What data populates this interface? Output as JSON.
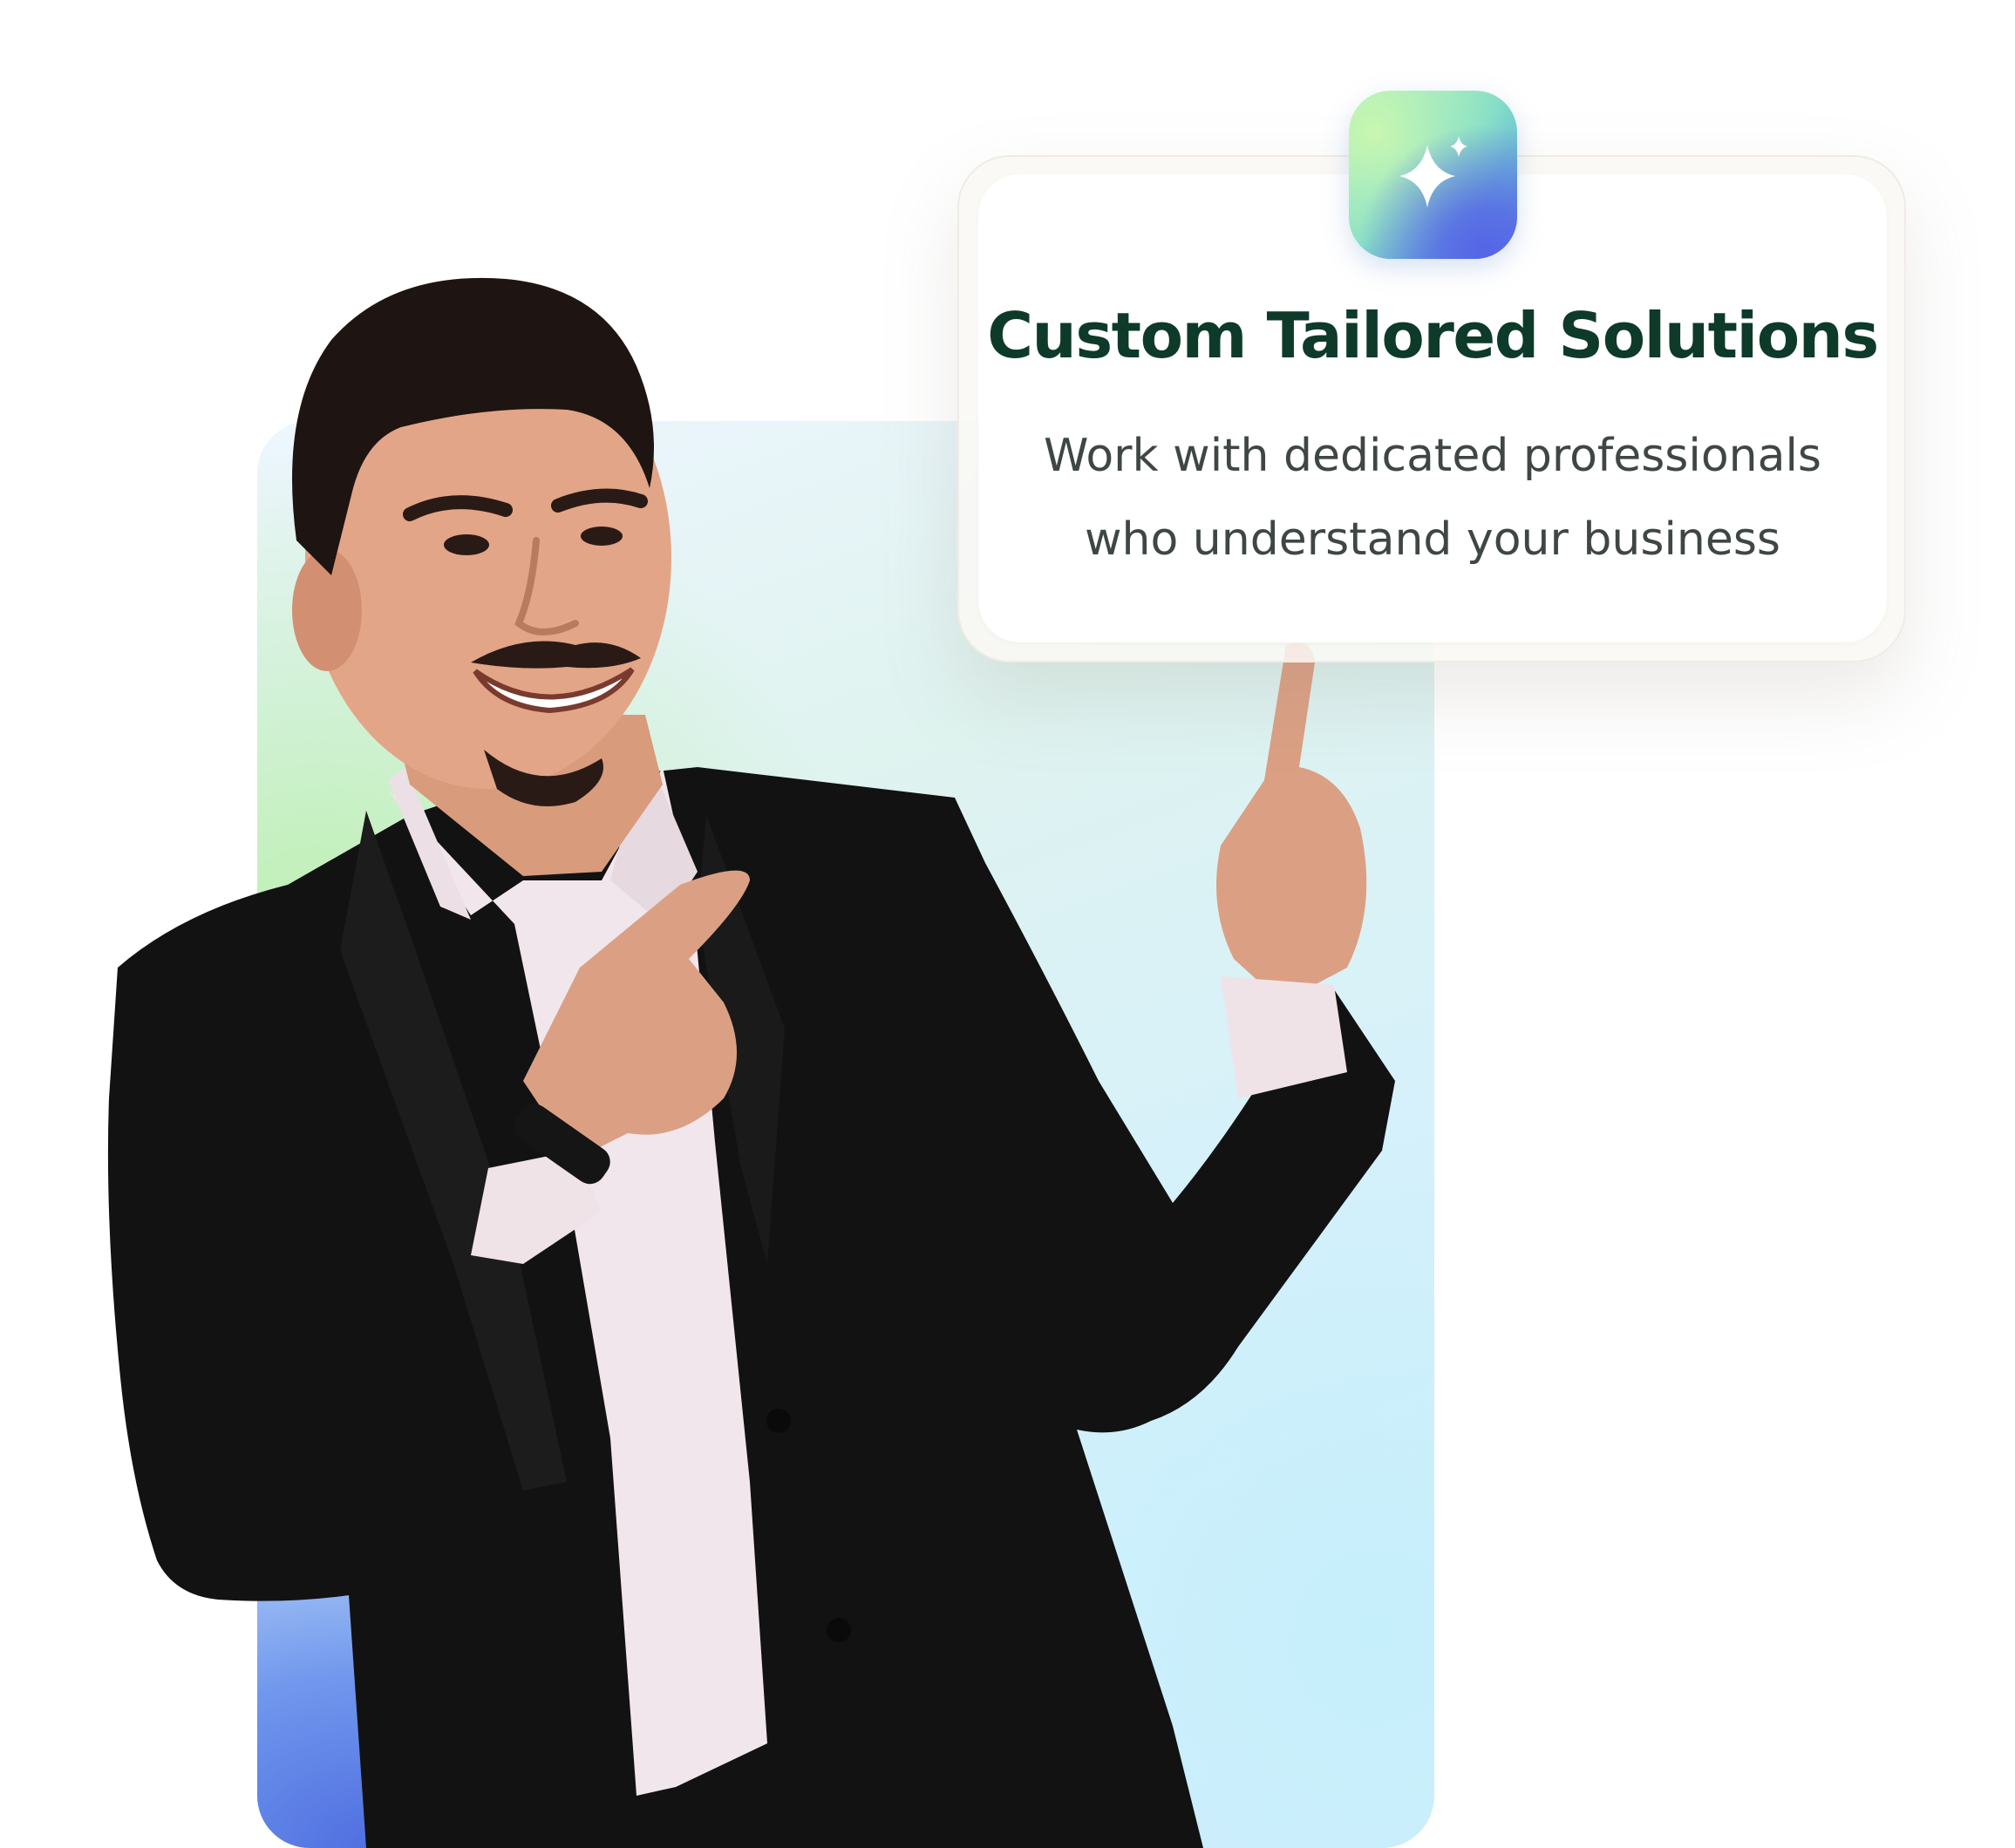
{
  "card": {
    "title": "Custom Tailored Solutions",
    "body_line_1": "Work with dedicated professionals",
    "body_line_2": "who understand your business",
    "icon": "sparkle-icon"
  },
  "colors": {
    "title": "#0e3a2a",
    "body": "#3e4743",
    "gradient_green": "#bff0b4",
    "gradient_blue": "#4f6fe0",
    "gradient_cyan": "#c5effb"
  },
  "image": {
    "subject": "person-pointing-illustration"
  }
}
